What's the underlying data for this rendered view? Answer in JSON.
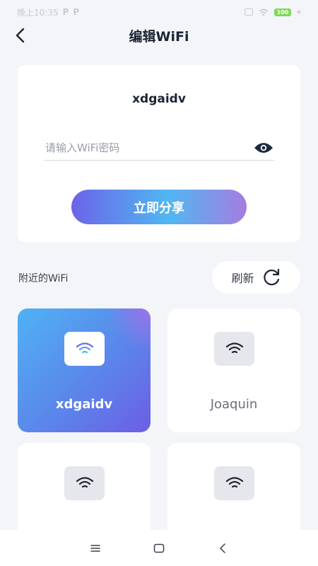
{
  "status_bar": {
    "time": "晚上10:35",
    "notif_1": "P",
    "notif_2": "P",
    "battery": "100"
  },
  "header": {
    "title": "编辑WiFi"
  },
  "share_card": {
    "ssid": "xdgaidv",
    "password_placeholder": "请输入WiFi密码",
    "password_value": "",
    "share_label": "立即分享"
  },
  "nearby": {
    "label": "附近的WiFi",
    "refresh_label": "刷新",
    "networks": [
      {
        "name": "xdgaidv",
        "selected": true
      },
      {
        "name": "Joaquin",
        "selected": false
      },
      {
        "name": "",
        "selected": false
      },
      {
        "name": "",
        "selected": false
      }
    ]
  },
  "icons": {
    "back": "back-arrow-icon",
    "eye": "eye-icon",
    "refresh": "refresh-icon",
    "wifi": "wifi-icon"
  },
  "colors": {
    "background": "#f4f5f9",
    "card": "#ffffff",
    "accent_start": "#6c63e8",
    "accent_mid": "#4fb7f2",
    "accent_end": "#a57de0",
    "text_primary": "#1d2433"
  }
}
